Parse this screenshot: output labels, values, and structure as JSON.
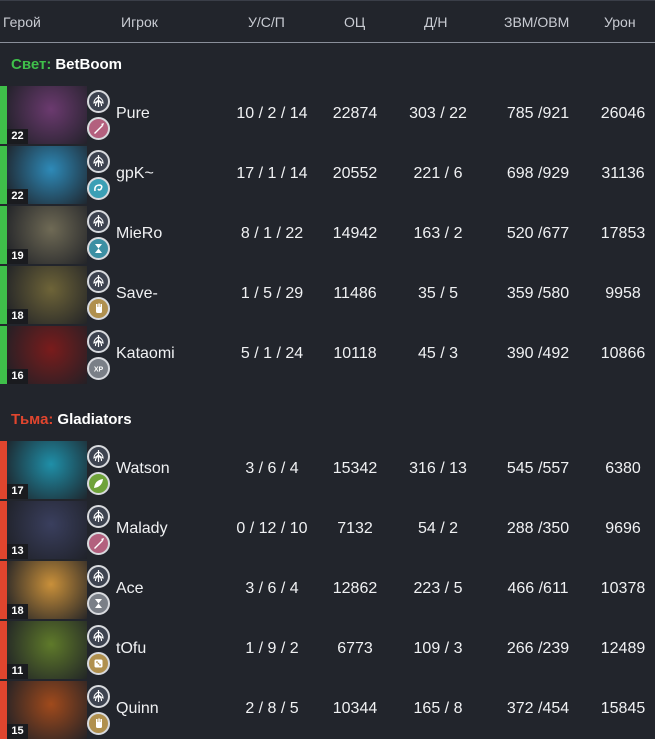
{
  "columns": {
    "hero": "Герой",
    "player": "Игрок",
    "ksd": "У/С/П",
    "networth": "ОЦ",
    "lhdn": "Д/Н",
    "gpm_xpm": "ЗВМ/ОВМ",
    "damage": "Урон"
  },
  "colors": {
    "radiant": "#3fbf4a",
    "dire": "#e0452e",
    "background": "#22252c"
  },
  "teams": [
    {
      "side_label": "Свет:",
      "name": "BetBoom",
      "players": [
        {
          "hero_icon": "hero-portrait",
          "level": "22",
          "player": "Pure",
          "ksd": "10 / 2 / 14",
          "networth": "22874",
          "lhdn": "303 / 22",
          "gpm_xpm": "785 /921",
          "damage": "26046",
          "role_icon": "dagger-icon",
          "role_color": "#b3607e",
          "portrait_color": "#6b3a6f"
        },
        {
          "hero_icon": "hero-portrait",
          "level": "22",
          "player": "gpK~",
          "ksd": "17 / 1 / 14",
          "networth": "20552",
          "lhdn": "221 / 6",
          "gpm_xpm": "698 /929",
          "damage": "31136",
          "role_icon": "swirl-icon",
          "role_color": "#3b9fb5",
          "portrait_color": "#2e8ab8"
        },
        {
          "hero_icon": "hero-portrait",
          "level": "19",
          "player": "MieRo",
          "ksd": "8 / 1 / 22",
          "networth": "14942",
          "lhdn": "163 / 2",
          "gpm_xpm": "520 /677",
          "damage": "17853",
          "role_icon": "hourglass-icon",
          "role_color": "#3c8fa3",
          "portrait_color": "#6f6a55"
        },
        {
          "hero_icon": "hero-portrait",
          "level": "18",
          "player": "Save-",
          "ksd": "1 / 5 / 29",
          "networth": "11486",
          "lhdn": "35 / 5",
          "gpm_xpm": "359 /580",
          "damage": "9958",
          "role_icon": "hand-icon",
          "role_color": "#b0904e",
          "portrait_color": "#6e6438"
        },
        {
          "hero_icon": "hero-portrait",
          "level": "16",
          "player": "Kataomi",
          "ksd": "5 / 1 / 24",
          "networth": "10118",
          "lhdn": "45 / 3",
          "gpm_xpm": "390 /492",
          "damage": "10866",
          "role_icon": "xp-icon",
          "role_color": "#7a7f87",
          "portrait_color": "#7a1c1c"
        }
      ]
    },
    {
      "side_label": "Тьма:",
      "name": "Gladiators",
      "players": [
        {
          "hero_icon": "hero-portrait",
          "level": "17",
          "player": "Watson",
          "ksd": "3 / 6 / 4",
          "networth": "15342",
          "lhdn": "316 / 13",
          "gpm_xpm": "545 /557",
          "damage": "6380",
          "role_icon": "leaf-icon",
          "role_color": "#6fa33a",
          "portrait_color": "#1f8fa8"
        },
        {
          "hero_icon": "hero-portrait",
          "level": "13",
          "player": "Malady",
          "ksd": "0 / 12 / 10",
          "networth": "7132",
          "lhdn": "54 / 2",
          "gpm_xpm": "288 /350",
          "damage": "9696",
          "role_icon": "dagger-icon",
          "role_color": "#b3607e",
          "portrait_color": "#3a3f5e"
        },
        {
          "hero_icon": "hero-portrait",
          "level": "18",
          "player": "Ace",
          "ksd": "3 / 6 / 4",
          "networth": "12862",
          "lhdn": "223 / 5",
          "gpm_xpm": "466 /611",
          "damage": "10378",
          "role_icon": "hourglass-icon",
          "role_color": "#7a7f87",
          "portrait_color": "#c9903a"
        },
        {
          "hero_icon": "hero-portrait",
          "level": "11",
          "player": "tOfu",
          "ksd": "1 / 9 / 2",
          "networth": "6773",
          "lhdn": "109 / 3",
          "gpm_xpm": "266 /239",
          "damage": "12489",
          "role_icon": "dice-icon",
          "role_color": "#b0904e",
          "portrait_color": "#5f7a2a"
        },
        {
          "hero_icon": "hero-portrait",
          "level": "15",
          "player": "Quinn",
          "ksd": "2 / 8 / 5",
          "networth": "10344",
          "lhdn": "165 / 8",
          "gpm_xpm": "372 /454",
          "damage": "15845",
          "role_icon": "hand-icon",
          "role_color": "#b0904e",
          "portrait_color": "#a04a1c"
        }
      ]
    }
  ]
}
